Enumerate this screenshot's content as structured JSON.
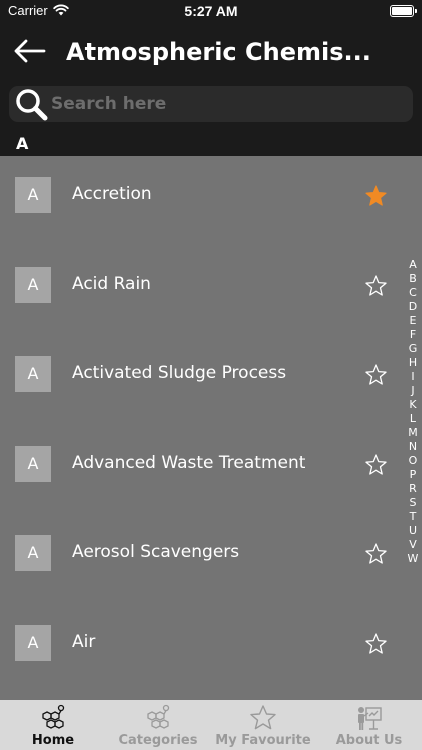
{
  "status_bar": {
    "carrier": "Carrier",
    "time": "5:27 AM"
  },
  "nav": {
    "title": "Atmospheric Chemis..."
  },
  "search": {
    "placeholder": "Search here"
  },
  "section": {
    "header": "A"
  },
  "colors": {
    "accent": "#f08a24",
    "list_background": "#747474",
    "badge_background": "#a5a5a5",
    "bar_background": "#1b1b1b"
  },
  "terms": [
    {
      "letter": "A",
      "label": "Accretion",
      "favourite": true
    },
    {
      "letter": "A",
      "label": "Acid Rain",
      "favourite": false
    },
    {
      "letter": "A",
      "label": "Activated Sludge Process",
      "favourite": false
    },
    {
      "letter": "A",
      "label": "Advanced Waste Treatment",
      "favourite": false
    },
    {
      "letter": "A",
      "label": "Aerosol Scavengers",
      "favourite": false
    },
    {
      "letter": "A",
      "label": "Air",
      "favourite": false
    }
  ],
  "index_letters": [
    "A",
    "B",
    "C",
    "D",
    "E",
    "F",
    "G",
    "H",
    "I",
    "J",
    "K",
    "L",
    "M",
    "N",
    "O",
    "P",
    "R",
    "S",
    "T",
    "U",
    "V",
    "W"
  ],
  "tabs": [
    {
      "label": "Home",
      "icon": "molecule-icon",
      "active": true
    },
    {
      "label": "Categories",
      "icon": "molecule-icon",
      "active": false
    },
    {
      "label": "My Favourite",
      "icon": "star-icon",
      "active": false
    },
    {
      "label": "About Us",
      "icon": "presenter-icon",
      "active": false
    }
  ]
}
